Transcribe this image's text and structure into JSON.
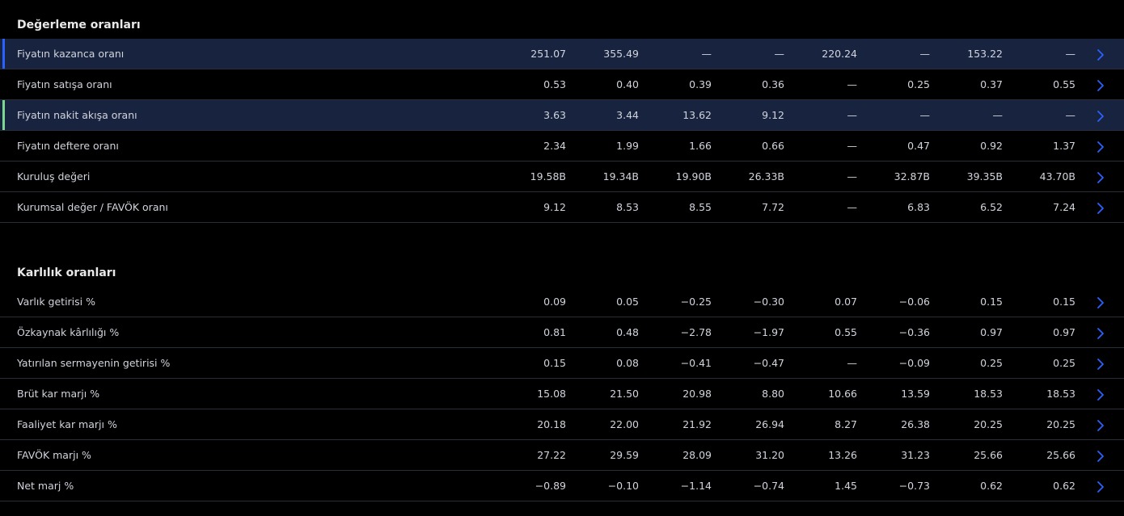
{
  "colors": {
    "highlight_row": "#17233f",
    "marker_blue": "#2962ff",
    "marker_green": "#7bd88f",
    "chevron": "#2962ff"
  },
  "sections": [
    {
      "title": "Değerleme oranları",
      "rows": [
        {
          "label": "Fiyatın kazanca oranı",
          "values": [
            "251.07",
            "355.49",
            "—",
            "—",
            "220.24",
            "—",
            "153.22",
            "—"
          ],
          "highlight": true,
          "marker": "blue"
        },
        {
          "label": "Fiyatın satışa oranı",
          "values": [
            "0.53",
            "0.40",
            "0.39",
            "0.36",
            "—",
            "0.25",
            "0.37",
            "0.55"
          ],
          "highlight": false,
          "marker": ""
        },
        {
          "label": "Fiyatın nakit akışa oranı",
          "values": [
            "3.63",
            "3.44",
            "13.62",
            "9.12",
            "—",
            "—",
            "—",
            "—"
          ],
          "highlight": true,
          "marker": "green"
        },
        {
          "label": "Fiyatın deftere oranı",
          "values": [
            "2.34",
            "1.99",
            "1.66",
            "0.66",
            "—",
            "0.47",
            "0.92",
            "1.37"
          ],
          "highlight": false,
          "marker": ""
        },
        {
          "label": "Kuruluş değeri",
          "values": [
            "19.58B",
            "19.34B",
            "19.90B",
            "26.33B",
            "—",
            "32.87B",
            "39.35B",
            "43.70B"
          ],
          "highlight": false,
          "marker": ""
        },
        {
          "label": "Kurumsal değer / FAVÖK oranı",
          "values": [
            "9.12",
            "8.53",
            "8.55",
            "7.72",
            "—",
            "6.83",
            "6.52",
            "7.24"
          ],
          "highlight": false,
          "marker": ""
        }
      ]
    },
    {
      "title": "Karlılık oranları",
      "rows": [
        {
          "label": "Varlık getirisi %",
          "values": [
            "0.09",
            "0.05",
            "−0.25",
            "−0.30",
            "0.07",
            "−0.06",
            "0.15",
            "0.15"
          ],
          "highlight": false,
          "marker": ""
        },
        {
          "label": "Özkaynak kârlılığı %",
          "values": [
            "0.81",
            "0.48",
            "−2.78",
            "−1.97",
            "0.55",
            "−0.36",
            "0.97",
            "0.97"
          ],
          "highlight": false,
          "marker": ""
        },
        {
          "label": "Yatırılan sermayenin getirisi %",
          "values": [
            "0.15",
            "0.08",
            "−0.41",
            "−0.47",
            "—",
            "−0.09",
            "0.25",
            "0.25"
          ],
          "highlight": false,
          "marker": ""
        },
        {
          "label": "Brüt kar marjı %",
          "values": [
            "15.08",
            "21.50",
            "20.98",
            "8.80",
            "10.66",
            "13.59",
            "18.53",
            "18.53"
          ],
          "highlight": false,
          "marker": ""
        },
        {
          "label": "Faaliyet kar marjı %",
          "values": [
            "20.18",
            "22.00",
            "21.92",
            "26.94",
            "8.27",
            "26.38",
            "20.25",
            "20.25"
          ],
          "highlight": false,
          "marker": ""
        },
        {
          "label": "FAVÖK marjı %",
          "values": [
            "27.22",
            "29.59",
            "28.09",
            "31.20",
            "13.26",
            "31.23",
            "25.66",
            "25.66"
          ],
          "highlight": false,
          "marker": ""
        },
        {
          "label": "Net marj %",
          "values": [
            "−0.89",
            "−0.10",
            "−1.14",
            "−0.74",
            "1.45",
            "−0.73",
            "0.62",
            "0.62"
          ],
          "highlight": false,
          "marker": ""
        }
      ]
    }
  ]
}
